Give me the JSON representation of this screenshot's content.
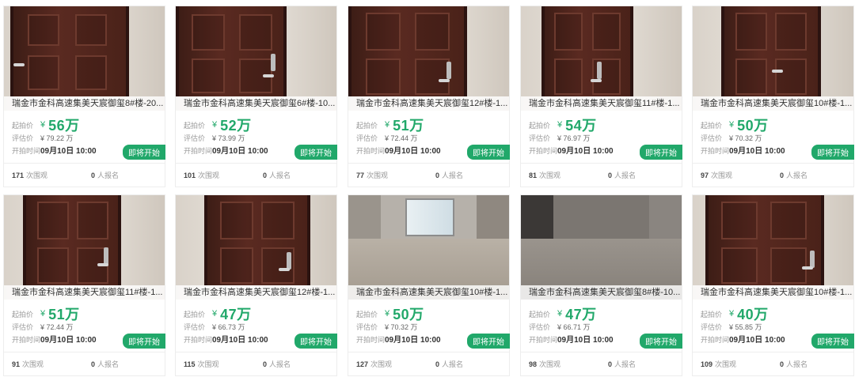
{
  "labels": {
    "start_price": "起拍价",
    "estimate": "评估价",
    "start_time": "开拍时间",
    "views_suffix": "次围观",
    "signups_suffix": "人报名",
    "currency": "¥"
  },
  "colors": {
    "accent": "#21a86a"
  },
  "listings": [
    {
      "title": "瑞金市金科高速集美天宸御玺8#楼-20...",
      "price": "56万",
      "estimate": "¥ 79.22 万",
      "time": "09月10日 10:00",
      "status": "即将开始",
      "views": "171",
      "signups": "0",
      "photo": "door"
    },
    {
      "title": "瑞金市金科高速集美天宸御玺6#楼-10...",
      "price": "52万",
      "estimate": "¥ 73.99 万",
      "time": "09月10日 10:00",
      "status": "即将开始",
      "views": "101",
      "signups": "0",
      "photo": "door"
    },
    {
      "title": "瑞金市金科高速集美天宸御玺12#楼-1...",
      "price": "51万",
      "estimate": "¥ 72.44 万",
      "time": "09月10日 10:00",
      "status": "即将开始",
      "views": "77",
      "signups": "0",
      "photo": "door"
    },
    {
      "title": "瑞金市金科高速集美天宸御玺11#楼-1...",
      "price": "54万",
      "estimate": "¥ 76.97 万",
      "time": "09月10日 10:00",
      "status": "即将开始",
      "views": "81",
      "signups": "0",
      "photo": "door"
    },
    {
      "title": "瑞金市金科高速集美天宸御玺10#楼-1...",
      "price": "50万",
      "estimate": "¥ 70.32 万",
      "time": "09月10日 10:00",
      "status": "即将开始",
      "views": "97",
      "signups": "0",
      "photo": "door"
    },
    {
      "title": "瑞金市金科高速集美天宸御玺11#楼-1...",
      "price": "51万",
      "estimate": "¥ 72.44 万",
      "time": "09月10日 10:00",
      "status": "即将开始",
      "views": "91",
      "signups": "0",
      "photo": "door"
    },
    {
      "title": "瑞金市金科高速集美天宸御玺12#楼-1...",
      "price": "47万",
      "estimate": "¥ 66.73 万",
      "time": "09月10日 10:00",
      "status": "即将开始",
      "views": "115",
      "signups": "0",
      "photo": "door"
    },
    {
      "title": "瑞金市金科高速集美天宸御玺10#楼-1...",
      "price": "50万",
      "estimate": "¥ 70.32 万",
      "time": "09月10日 10:00",
      "status": "即将开始",
      "views": "127",
      "signups": "0",
      "photo": "room-window"
    },
    {
      "title": "瑞金市金科高速集美天宸御玺8#楼-10...",
      "price": "47万",
      "estimate": "¥ 66.71 万",
      "time": "09月10日 10:00",
      "status": "即将开始",
      "views": "98",
      "signups": "0",
      "photo": "room-concrete"
    },
    {
      "title": "瑞金市金科高速集美天宸御玺10#楼-1...",
      "price": "40万",
      "estimate": "¥ 55.85 万",
      "time": "09月10日 10:00",
      "status": "即将开始",
      "views": "109",
      "signups": "0",
      "photo": "door"
    }
  ]
}
